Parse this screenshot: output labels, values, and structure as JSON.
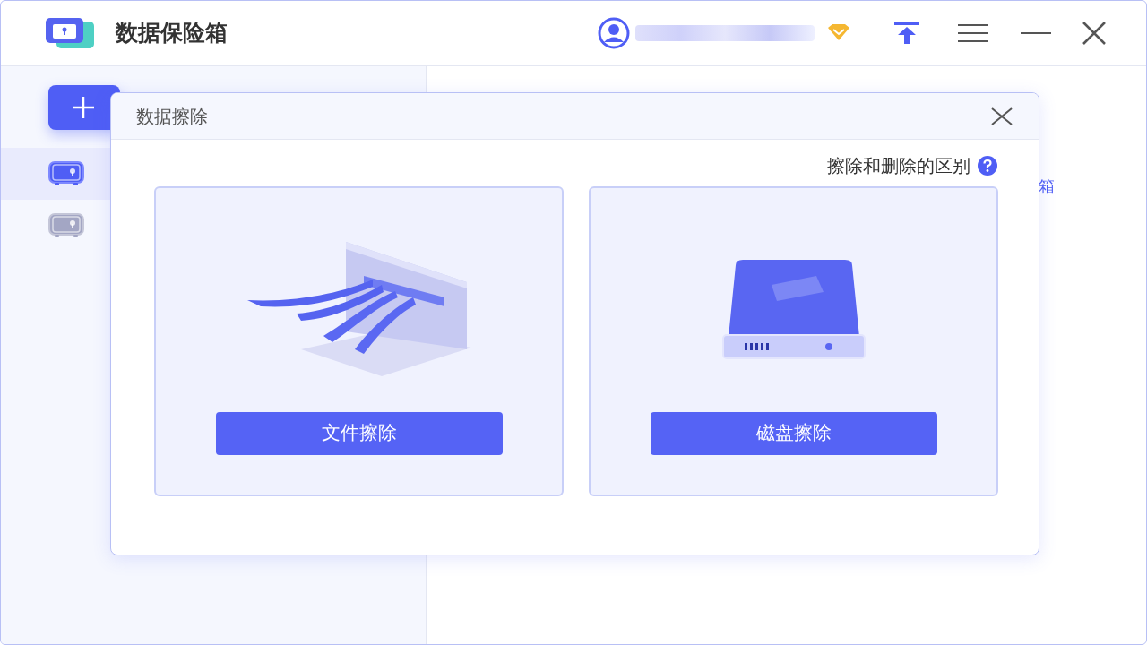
{
  "app": {
    "title": "数据保险箱"
  },
  "sidebar": {
    "items": [
      {
        "selected": true
      },
      {
        "selected": false
      }
    ]
  },
  "main": {
    "partial_text": "箱"
  },
  "dialog": {
    "title": "数据擦除",
    "help_link": "擦除和删除的区别",
    "options": [
      {
        "kind": "file",
        "button": "文件擦除"
      },
      {
        "kind": "disk",
        "button": "磁盘擦除"
      }
    ]
  }
}
